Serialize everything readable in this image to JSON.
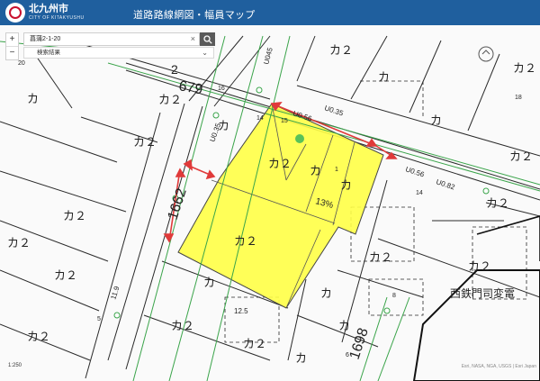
{
  "header": {
    "brand": "北九州市",
    "brand_sub": "CITY OF KITAKYUSHU",
    "title": "道路路線網図・幅員マップ"
  },
  "search": {
    "value": "菖蒲2-1-20",
    "clear_symbol": "×",
    "results_label": "検索結果",
    "results_chevron": "⌄"
  },
  "zoom": {
    "in": "+",
    "out": "−"
  },
  "scale": {
    "label": "1:250"
  },
  "attribution": "Esri, NASA, NGA, USGS | Esri Japan",
  "map": {
    "highlight_color": "#ffff46",
    "road_centerline_color": "#3aa44a",
    "measure_color": "#e03a3a",
    "point_color": "#59c259",
    "plan_labels": {
      "d1": "2",
      "d2": "679",
      "d3": "16",
      "d4": "14",
      "d5": "U045",
      "d6": "U0.35",
      "d7": "U0.56",
      "d8": "U0.35",
      "d9": "U0.56",
      "d10": "U0.82",
      "d11": "15",
      "d12": "1662",
      "d13": "11.9",
      "d14": "12.5",
      "d15": "1698",
      "d16": "8",
      "d17": "5",
      "d18": "6",
      "d19": "1",
      "d20": "13%",
      "d21": "20",
      "d22": "西鉄門司変電",
      "d23": "14",
      "d24": "18",
      "d25": "1"
    },
    "zone_labels": {
      "z1": "カ",
      "z2": "カ２",
      "z3": "カ",
      "z4": "カ２",
      "z5": "カ",
      "z6": "カ２",
      "z7": "カ２",
      "z8": "カ２",
      "z9": "カ２",
      "z10": "カ２",
      "z11": "カ２",
      "z12": "カ２",
      "z13": "カ２",
      "z14": "カ２",
      "z15": "カ",
      "z16": "カ",
      "z17": "カ２",
      "z18": "カ",
      "z19": "カ",
      "z20": "カ２",
      "z21": "カ",
      "z22": "カ２",
      "z23": "カ",
      "z24": "カ２",
      "z25": "カ２",
      "z26": "カ"
    }
  }
}
